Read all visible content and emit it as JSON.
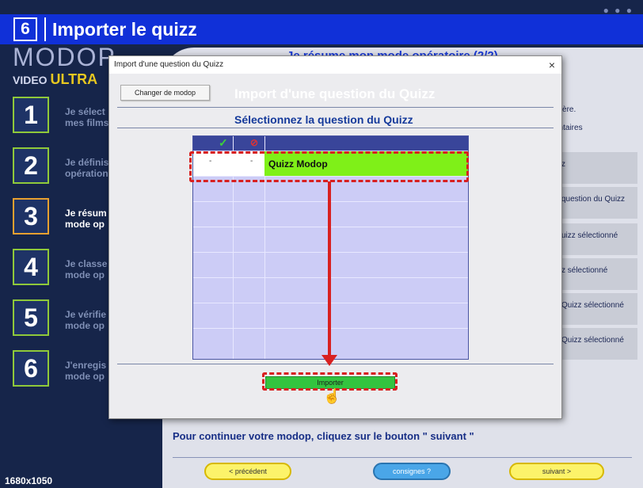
{
  "banner": {
    "step_number": "6",
    "title": "Importer le quizz"
  },
  "logo": {
    "brand": "MODOP",
    "video": "VIDEO",
    "ultra": "ULTRA"
  },
  "left_steps": [
    {
      "num": "1",
      "line1": "Je sélect",
      "line2": "mes films"
    },
    {
      "num": "2",
      "line1": "Je définis",
      "line2": "opération"
    },
    {
      "num": "3",
      "line1": "Je résum",
      "line2": "mode op"
    },
    {
      "num": "4",
      "line1": "Je classe",
      "line2": "mode op"
    },
    {
      "num": "5",
      "line1": "Je vérifie",
      "line2": "mode op"
    },
    {
      "num": "6",
      "line1": "J'enregis",
      "line2": "mode op"
    }
  ],
  "resolution": "1680x1050",
  "background": {
    "title": "Je résume mon mode opératoire (2/2)",
    "right_texts": [
      "ulière.",
      "entaires"
    ],
    "right_buttons": [
      "z",
      "question du Quizz",
      "uizz sélectionné",
      "z sélectionné",
      "Quizz sélectionné",
      "Quizz sélectionné"
    ],
    "continue_text": "Pour continuer votre modop, cliquez sur le bouton \" suivant \"",
    "nav": {
      "prev": "< précédent",
      "consignes": "consignes ?",
      "next": "suivant >"
    }
  },
  "dialog": {
    "window_title": "Import d'une question du Quizz",
    "close": "×",
    "changer_label": "Changer de modop",
    "header": "Import d'une question du Quizz",
    "subheader": "Sélectionnez la question du Quizz",
    "grid": {
      "header_check": "✓",
      "header_cross": "⊘",
      "rows": [
        {
          "c1": "-",
          "c2": "-",
          "name": "Quizz Modop"
        }
      ]
    },
    "importer_label": "Importer"
  },
  "colors": {
    "banner": "#1030d8",
    "highlight": "#d82020",
    "row_selected": "#7ff018",
    "import_button": "#33c43f"
  }
}
